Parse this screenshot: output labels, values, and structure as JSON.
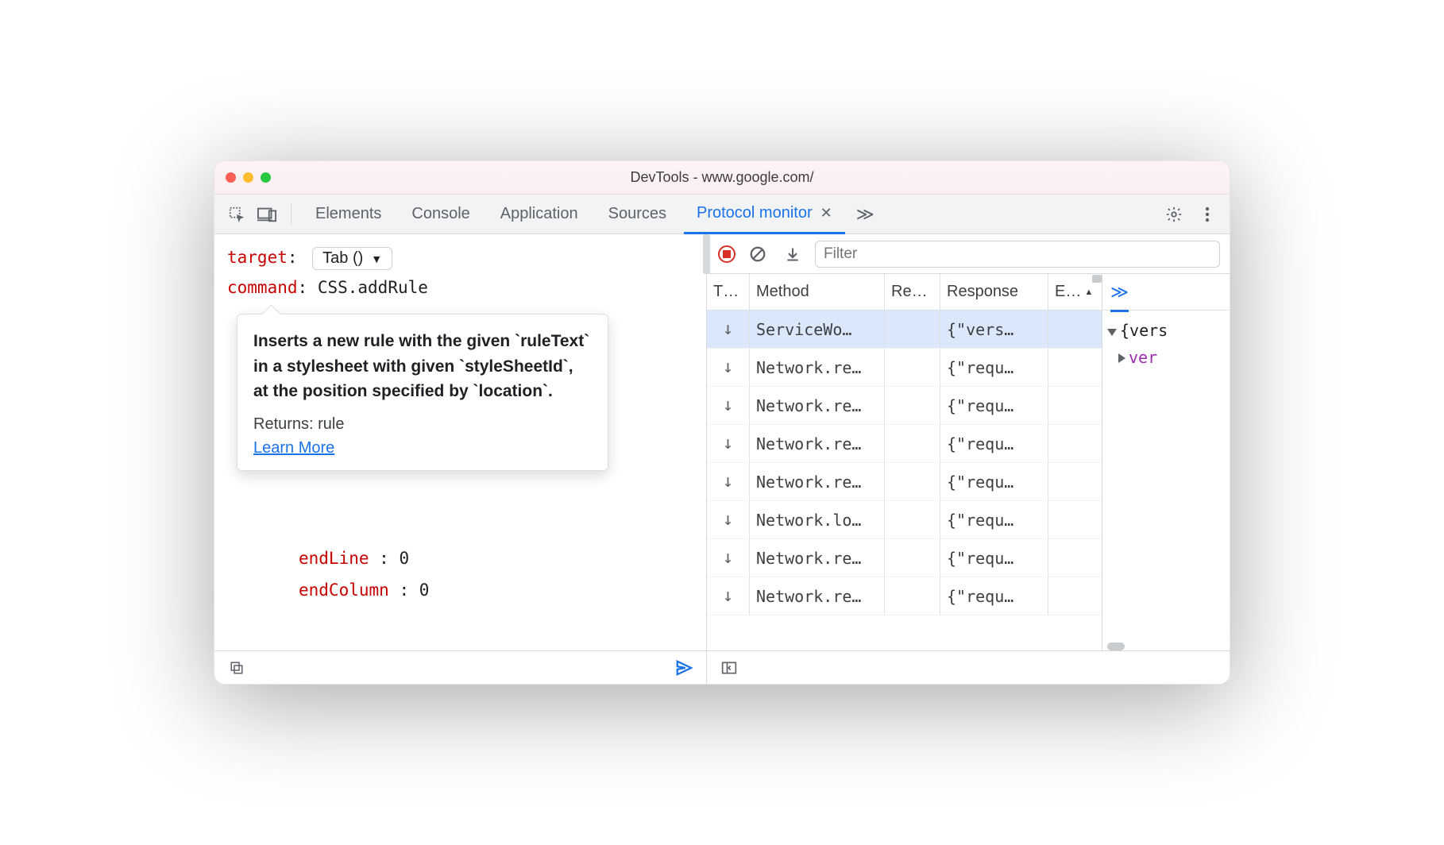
{
  "window": {
    "title": "DevTools - www.google.com/"
  },
  "tabs": {
    "items": [
      "Elements",
      "Console",
      "Application",
      "Sources",
      "Protocol monitor"
    ],
    "active_index": 4
  },
  "editor": {
    "target_label": "target",
    "target_value": "Tab ()",
    "command_label": "command",
    "command_value": "CSS.addRule",
    "tooltip": {
      "desc": "Inserts a new rule with the given `ruleText` in a stylesheet with given `styleSheetId`, at the position specified by `location`.",
      "returns": "Returns: rule",
      "link": "Learn More"
    },
    "lines": [
      {
        "k": "endLine",
        "v": "0"
      },
      {
        "k": "endColumn",
        "v": "0"
      }
    ]
  },
  "monitor": {
    "filter_placeholder": "Filter",
    "columns": {
      "t": "T…",
      "method": "Method",
      "re": "Re…",
      "response": "Response",
      "e": "E…"
    },
    "rows": [
      {
        "method": "ServiceWo…",
        "response": "{\"vers…",
        "selected": true
      },
      {
        "method": "Network.re…",
        "response": "{\"requ…"
      },
      {
        "method": "Network.re…",
        "response": "{\"requ…"
      },
      {
        "method": "Network.re…",
        "response": "{\"requ…"
      },
      {
        "method": "Network.re…",
        "response": "{\"requ…"
      },
      {
        "method": "Network.lo…",
        "response": "{\"requ…"
      },
      {
        "method": "Network.re…",
        "response": "{\"requ…"
      },
      {
        "method": "Network.re…",
        "response": "{\"requ…"
      }
    ],
    "tree": {
      "root": "{vers",
      "prop": "ver"
    }
  }
}
